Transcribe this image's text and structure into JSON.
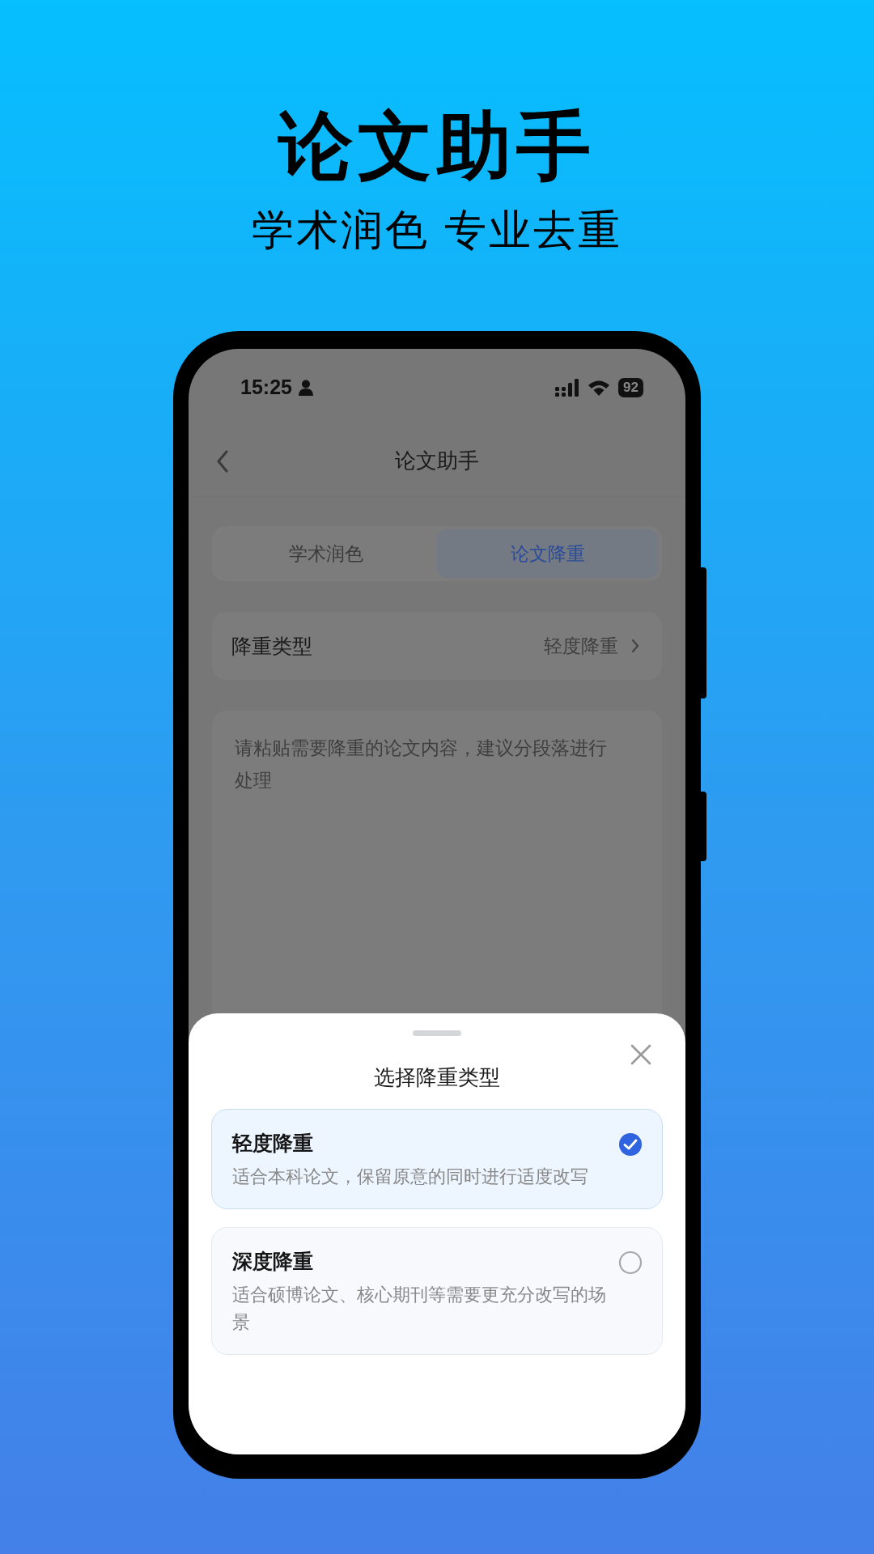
{
  "promo": {
    "title": "论文助手",
    "subtitle": "学术润色 专业去重"
  },
  "status_bar": {
    "time": "15:25",
    "battery": "92"
  },
  "nav": {
    "title": "论文助手"
  },
  "tabs": [
    {
      "label": "学术润色",
      "selected": false
    },
    {
      "label": "论文降重",
      "selected": true
    }
  ],
  "type_row": {
    "label": "降重类型",
    "value": "轻度降重"
  },
  "editor": {
    "placeholder": "请粘贴需要降重的论文内容，建议分段落进行处理"
  },
  "sheet": {
    "title": "选择降重类型",
    "options": [
      {
        "title": "轻度降重",
        "description": "适合本科论文，保留原意的同时进行适度改写",
        "selected": true
      },
      {
        "title": "深度降重",
        "description": "适合硕博论文、核心期刊等需要更充分改写的场景",
        "selected": false
      }
    ]
  }
}
